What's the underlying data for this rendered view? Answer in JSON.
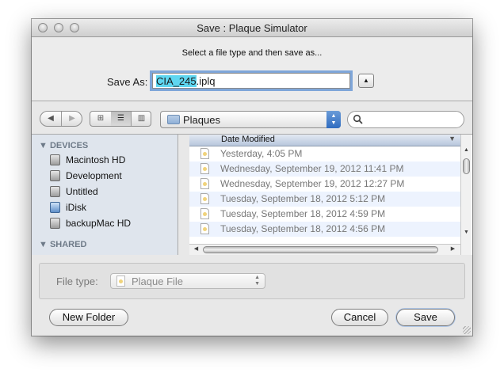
{
  "window": {
    "title": "Save : Plaque Simulator"
  },
  "save_panel": {
    "instruction": "Select a file type and then save as...",
    "save_as_label": "Save As:",
    "filename_selected": "CIA_245",
    "filename_extension": ".iplq"
  },
  "toolbar": {
    "location": "Plaques",
    "search_value": ""
  },
  "sidebar": {
    "devices_header": "DEVICES",
    "devices": [
      {
        "label": "Macintosh HD",
        "icon": "hard-drive-icon"
      },
      {
        "label": "Development",
        "icon": "hard-drive-icon"
      },
      {
        "label": "Untitled",
        "icon": "hard-drive-icon"
      },
      {
        "label": "iDisk",
        "icon": "idisk-icon"
      },
      {
        "label": "backupMac HD",
        "icon": "hard-drive-icon"
      }
    ],
    "shared_header": "SHARED"
  },
  "file_list": {
    "column_header": "Date Modified",
    "rows": [
      {
        "date": "Yesterday, 4:05 PM"
      },
      {
        "date": "Wednesday, September 19, 2012 11:41 PM"
      },
      {
        "date": "Wednesday, September 19, 2012 12:27 PM"
      },
      {
        "date": "Tuesday, September 18, 2012 5:12 PM"
      },
      {
        "date": "Tuesday, September 18, 2012 4:59 PM"
      },
      {
        "date": "Tuesday, September 18, 2012 4:56 PM"
      }
    ]
  },
  "file_type": {
    "label": "File type:",
    "value": "Plaque File"
  },
  "buttons": {
    "new_folder": "New Folder",
    "cancel": "Cancel",
    "save": "Save"
  },
  "colors": {
    "selection": "#5fd6f0",
    "focus_ring": "#7fa6d9",
    "sidebar_bg": "#dfe5ed",
    "alt_row": "#edf3fe"
  }
}
